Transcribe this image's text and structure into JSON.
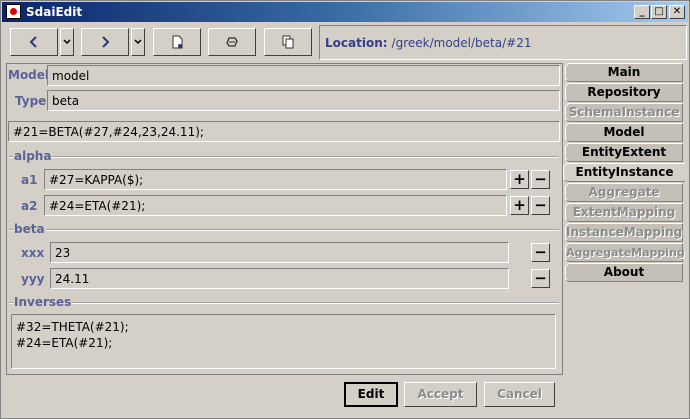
{
  "window": {
    "title": "SdaiEdit",
    "controls": {
      "minimize": "_",
      "maximize": "□",
      "close": "✕"
    }
  },
  "toolbar": {
    "back_icon": "back-arrow-icon",
    "forward_icon": "forward-arrow-icon",
    "dropdown_icon": "chevron-down-icon",
    "new_icon": "new-document-icon",
    "refresh_icon": "refresh-icon",
    "copy_icon": "copy-icon"
  },
  "location": {
    "label": "Location:",
    "value": "/greek/model/beta/#21"
  },
  "entity": {
    "model_label": "Model",
    "model_value": "model",
    "type_label": "Type",
    "type_value": "beta",
    "instance_text": "#21=BETA(#27,#24,23,24.11);"
  },
  "groups": {
    "alpha": {
      "title": "alpha",
      "rows": [
        {
          "label": "a1",
          "value": "#27=KAPPA($);"
        },
        {
          "label": "a2",
          "value": "#24=ETA(#21);"
        }
      ]
    },
    "beta": {
      "title": "beta",
      "rows": [
        {
          "label": "xxx",
          "value": "23"
        },
        {
          "label": "yyy",
          "value": "24.11"
        }
      ]
    },
    "inverses": {
      "title": "Inverses",
      "lines": [
        "#32=THETA(#21);",
        "#24=ETA(#21);"
      ]
    }
  },
  "buttons": {
    "plus": "+",
    "minus": "−",
    "edit": "Edit",
    "accept": "Accept",
    "cancel": "Cancel"
  },
  "tabs": [
    {
      "label": "Main",
      "state": "normal"
    },
    {
      "label": "Repository",
      "state": "normal"
    },
    {
      "label": "SchemaInstance",
      "state": "disabled"
    },
    {
      "label": "Model",
      "state": "normal"
    },
    {
      "label": "EntityExtent",
      "state": "normal"
    },
    {
      "label": "EntityInstance",
      "state": "selected"
    },
    {
      "label": "Aggregate",
      "state": "disabled"
    },
    {
      "label": "ExtentMapping",
      "state": "disabled"
    },
    {
      "label": "InstanceMapping",
      "state": "disabled"
    },
    {
      "label": "AggregateMapping",
      "state": "disabled"
    },
    {
      "label": "About",
      "state": "normal"
    }
  ],
  "colors": {
    "title_start": "#0a246a",
    "title_end": "#a6caf0",
    "label": "#5a6397",
    "face": "#d4d0c8"
  }
}
